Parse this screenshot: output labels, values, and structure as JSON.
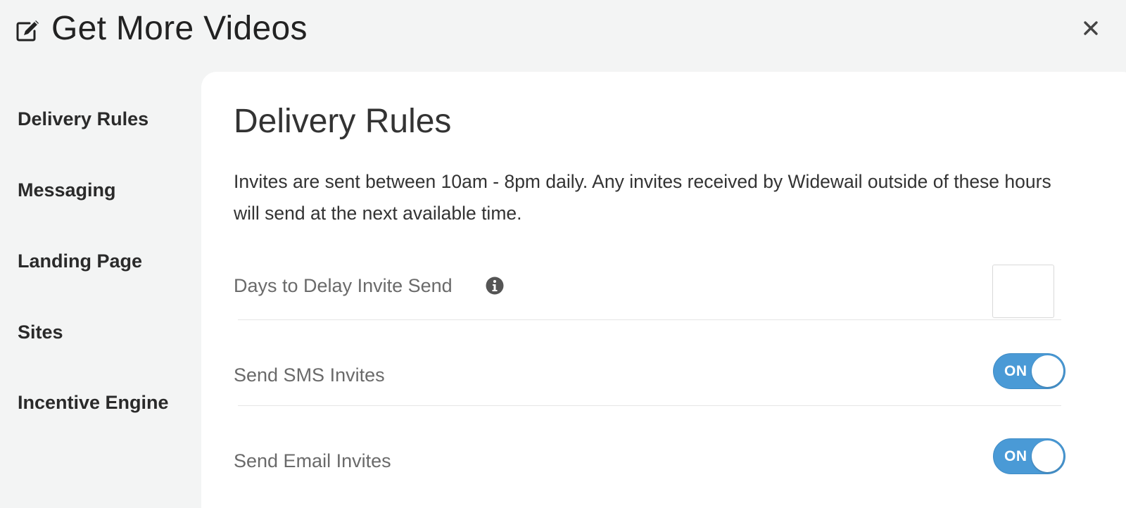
{
  "header": {
    "title": "Get More Videos",
    "icon": "edit-icon",
    "close_icon": "close-icon"
  },
  "sidebar": {
    "items": [
      {
        "label": "Delivery Rules"
      },
      {
        "label": "Messaging"
      },
      {
        "label": "Landing Page"
      },
      {
        "label": "Sites"
      },
      {
        "label": "Incentive Engine"
      }
    ]
  },
  "main": {
    "title": "Delivery Rules",
    "description": "Invites are sent between 10am - 8pm daily. Any invites received by Widewail outside of these hours will send at the next available time.",
    "delay": {
      "label": "Days to Delay Invite Send",
      "icon": "info-icon",
      "value": ""
    },
    "sms": {
      "label": "Send SMS Invites",
      "toggle_text": "ON"
    },
    "email": {
      "label": "Send Email Invites",
      "toggle_text": "ON"
    }
  },
  "colors": {
    "background": "#f3f4f4",
    "panel": "#ffffff",
    "toggle_on": "#4a9ad6"
  }
}
